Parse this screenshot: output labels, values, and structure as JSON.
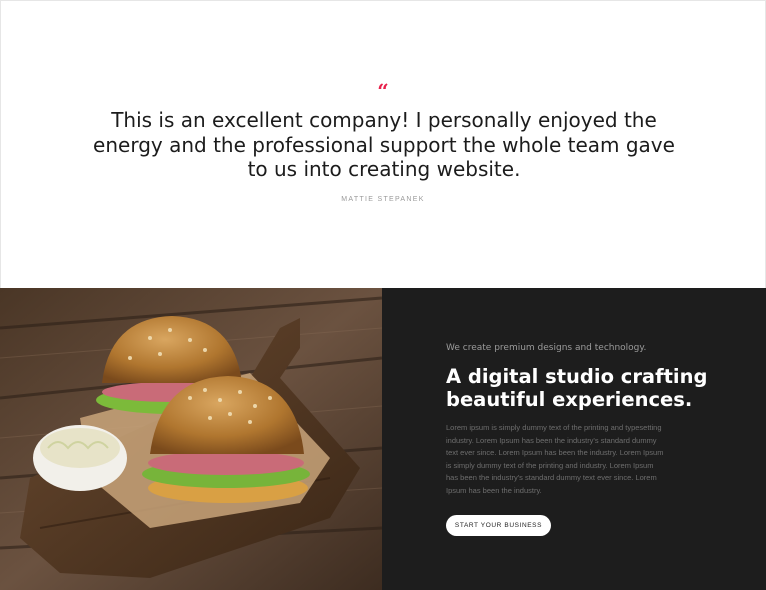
{
  "testimonial": {
    "quote_icon": "quote-open-icon",
    "quote_symbol": "“",
    "quote_color": "#e8214b",
    "text": "This is an excellent company! I personally enjoyed the energy and the professional support the whole team gave to us into creating website.",
    "author": "MATTIE STEPANEK"
  },
  "feature": {
    "image_subject": "food-photo",
    "eyebrow": "We create premium designs and technology.",
    "headline": "A digital studio crafting beautiful experiences.",
    "body": "Lorem ipsum is simply dummy text of the printing and typesetting industry. Lorem Ipsum has been the industry's standard dummy text ever since. Lorem Ipsum has been the industry. Lorem Ipsum is simply dummy text of the printing and industry. Lorem Ipsum has been the industry's standard dummy text ever since. Lorem Ipsum has been the industry.",
    "cta_label": "START YOUR BUSINESS",
    "background_color": "#1d1d1d"
  }
}
